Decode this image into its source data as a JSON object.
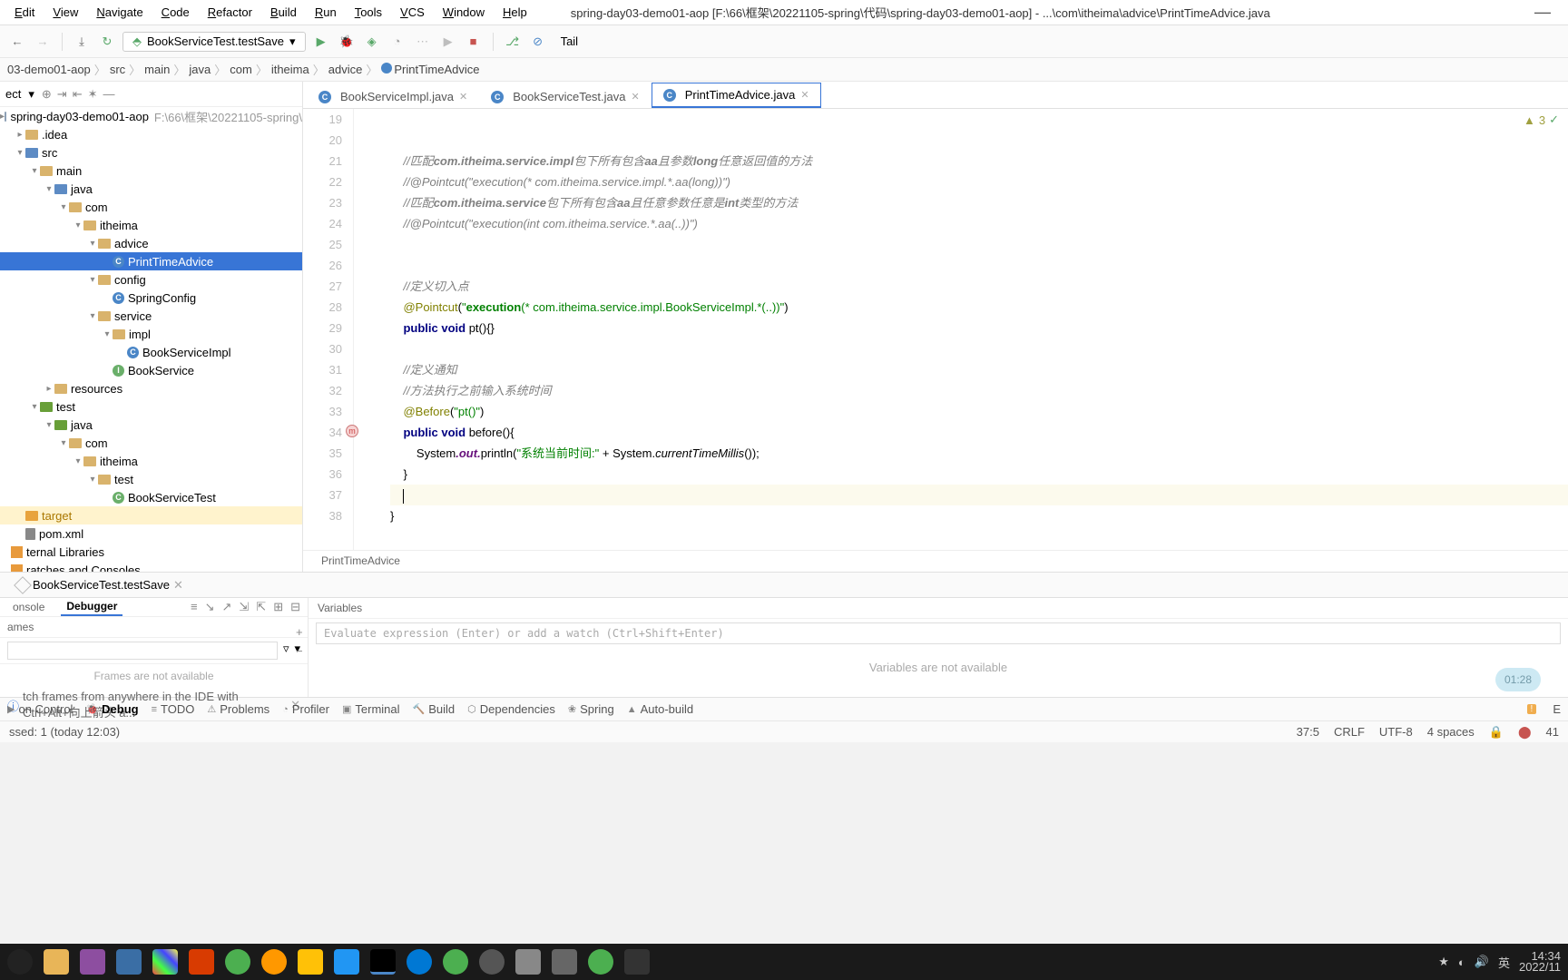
{
  "title": "spring-day03-demo01-aop [F:\\66\\框架\\20221105-spring\\代码\\spring-day03-demo01-aop] - ...\\com\\itheima\\advice\\PrintTimeAdvice.java",
  "menu": [
    "Edit",
    "View",
    "Navigate",
    "Code",
    "Refactor",
    "Build",
    "Run",
    "Tools",
    "VCS",
    "Window",
    "Help"
  ],
  "runConfig": "BookServiceTest.testSave",
  "tailLabel": "Tail",
  "breadcrumb": [
    "03-demo01-aop",
    "src",
    "main",
    "java",
    "com",
    "itheima",
    "advice",
    "PrintTimeAdvice"
  ],
  "project": {
    "title": "ect",
    "root": {
      "name": "spring-day03-demo01-aop",
      "path": "F:\\66\\框架\\20221105-spring\\"
    },
    "tree": [
      {
        "d": 0,
        "t": "root",
        "l": "spring-day03-demo01-aop",
        "extra": "F:\\66\\框架\\20221105-spring\\"
      },
      {
        "d": 1,
        "t": "folder",
        "l": ".idea"
      },
      {
        "d": 1,
        "t": "folder-blue",
        "l": "src",
        "open": true
      },
      {
        "d": 2,
        "t": "folder",
        "l": "main",
        "open": true
      },
      {
        "d": 3,
        "t": "folder-blue",
        "l": "java",
        "open": true
      },
      {
        "d": 4,
        "t": "folder",
        "l": "com",
        "open": true
      },
      {
        "d": 5,
        "t": "folder",
        "l": "itheima",
        "open": true
      },
      {
        "d": 6,
        "t": "folder",
        "l": "advice",
        "open": true
      },
      {
        "d": 7,
        "t": "class",
        "l": "PrintTimeAdvice",
        "sel": true
      },
      {
        "d": 6,
        "t": "folder",
        "l": "config",
        "open": true
      },
      {
        "d": 7,
        "t": "class",
        "l": "SpringConfig"
      },
      {
        "d": 6,
        "t": "folder",
        "l": "service",
        "open": true
      },
      {
        "d": 7,
        "t": "folder",
        "l": "impl",
        "open": true
      },
      {
        "d": 8,
        "t": "class",
        "l": "BookServiceImpl"
      },
      {
        "d": 7,
        "t": "iface",
        "l": "BookService"
      },
      {
        "d": 3,
        "t": "folder",
        "l": "resources"
      },
      {
        "d": 2,
        "t": "folder-green",
        "l": "test",
        "open": true
      },
      {
        "d": 3,
        "t": "folder-green",
        "l": "java",
        "open": true
      },
      {
        "d": 4,
        "t": "folder",
        "l": "com",
        "open": true
      },
      {
        "d": 5,
        "t": "folder",
        "l": "itheima",
        "open": true
      },
      {
        "d": 6,
        "t": "folder",
        "l": "test",
        "open": true
      },
      {
        "d": 7,
        "t": "class-g",
        "l": "BookServiceTest"
      },
      {
        "d": 1,
        "t": "target",
        "l": "target"
      },
      {
        "d": 1,
        "t": "file",
        "l": "pom.xml"
      },
      {
        "d": 0,
        "t": "lib",
        "l": "ternal Libraries"
      },
      {
        "d": 0,
        "t": "lib",
        "l": "ratches and Consoles"
      }
    ]
  },
  "tabs": [
    {
      "name": "BookServiceImpl.java",
      "active": false
    },
    {
      "name": "BookServiceTest.java",
      "active": false
    },
    {
      "name": "PrintTimeAdvice.java",
      "active": true
    }
  ],
  "hints": {
    "warn": "3"
  },
  "code": {
    "lines": [
      19,
      20,
      21,
      22,
      23,
      24,
      25,
      26,
      27,
      28,
      29,
      30,
      31,
      32,
      33,
      34,
      35,
      36,
      37,
      38
    ],
    "content": [
      {
        "t": "blank"
      },
      {
        "t": "blank"
      },
      {
        "t": "comment",
        "val": "//匹配",
        "bi": "com.itheima.service.impl",
        "tail": "包下所有包含",
        "bi2": "aa",
        "tail2": "且参数",
        "bi3": "long",
        "tail3": "任意返回值的方法"
      },
      {
        "t": "commentPlain",
        "val": "//@Pointcut(\"execution(* com.itheima.service.impl.*.aa(long))\")"
      },
      {
        "t": "comment",
        "val": "//匹配",
        "bi": "com.itheima.service",
        "tail": "包下所有包含",
        "bi2": "aa",
        "tail2": "且任意参数任意是",
        "bi3": "int",
        "tail3": "类型的方法"
      },
      {
        "t": "commentPlain",
        "val": "//@Pointcut(\"execution(int com.itheima.service.*.aa(..))\")"
      },
      {
        "t": "blank"
      },
      {
        "t": "blank"
      },
      {
        "t": "commentZ",
        "val": "//定义切入点"
      },
      {
        "t": "pointcut",
        "anno": "@Pointcut",
        "str1": "\"",
        "kw": "execution",
        "str2": "(* com.itheima.service.impl.BookServiceImpl.*(..))\""
      },
      {
        "t": "ptdef",
        "kw1": "public",
        "kw2": "void",
        "name": "pt",
        "suffix": "(){}"
      },
      {
        "t": "blank"
      },
      {
        "t": "commentZ",
        "val": "//定义通知"
      },
      {
        "t": "commentZ",
        "val": "//方法执行之前输入系统时间"
      },
      {
        "t": "before",
        "anno": "@Before",
        "str": "\"pt()\""
      },
      {
        "t": "beforedef",
        "kw1": "public",
        "kw2": "void",
        "name": "before",
        "suffix": "(){",
        "mark": true
      },
      {
        "t": "println",
        "sys": "System",
        "out": ".out.",
        "pr": "println(",
        "str": "\"系统当前时间:\"",
        "plus": " + System.",
        "m": "currentTimeMillis",
        "end": "());"
      },
      {
        "t": "plain",
        "val": "    }"
      },
      {
        "t": "caret",
        "val": "    "
      },
      {
        "t": "plain",
        "val": "}"
      }
    ]
  },
  "editorCrumb": "PrintTimeAdvice",
  "toolWindowTab": "BookServiceTest.testSave",
  "debug": {
    "tabs": [
      "onsole",
      "Debugger"
    ],
    "activeTab": 1,
    "framesHeader": "ames",
    "varsHeader": "Variables",
    "evalPlaceholder": "Evaluate expression (Enter) or add a watch (Ctrl+Shift+Enter)",
    "framesEmpty": "Frames are not available",
    "framesErr": "tch frames from anywhere in the IDE with Ctrl+Alt+向上箭头 a...",
    "varsEmpty": "Variables are not available"
  },
  "bottomTools": [
    "on Control",
    "Debug",
    "TODO",
    "Problems",
    "Profiler",
    "Terminal",
    "Build",
    "Dependencies",
    "Spring",
    "Auto-build"
  ],
  "status": {
    "left": "ssed: 1 (today 12:03)",
    "pos": "37:5",
    "eol": "CRLF",
    "enc": "UTF-8",
    "indent": "4 spaces",
    "right": "41"
  },
  "floatBadge": "01:28",
  "taskbarClock": {
    "time": "14:34",
    "date": "2022/11"
  }
}
